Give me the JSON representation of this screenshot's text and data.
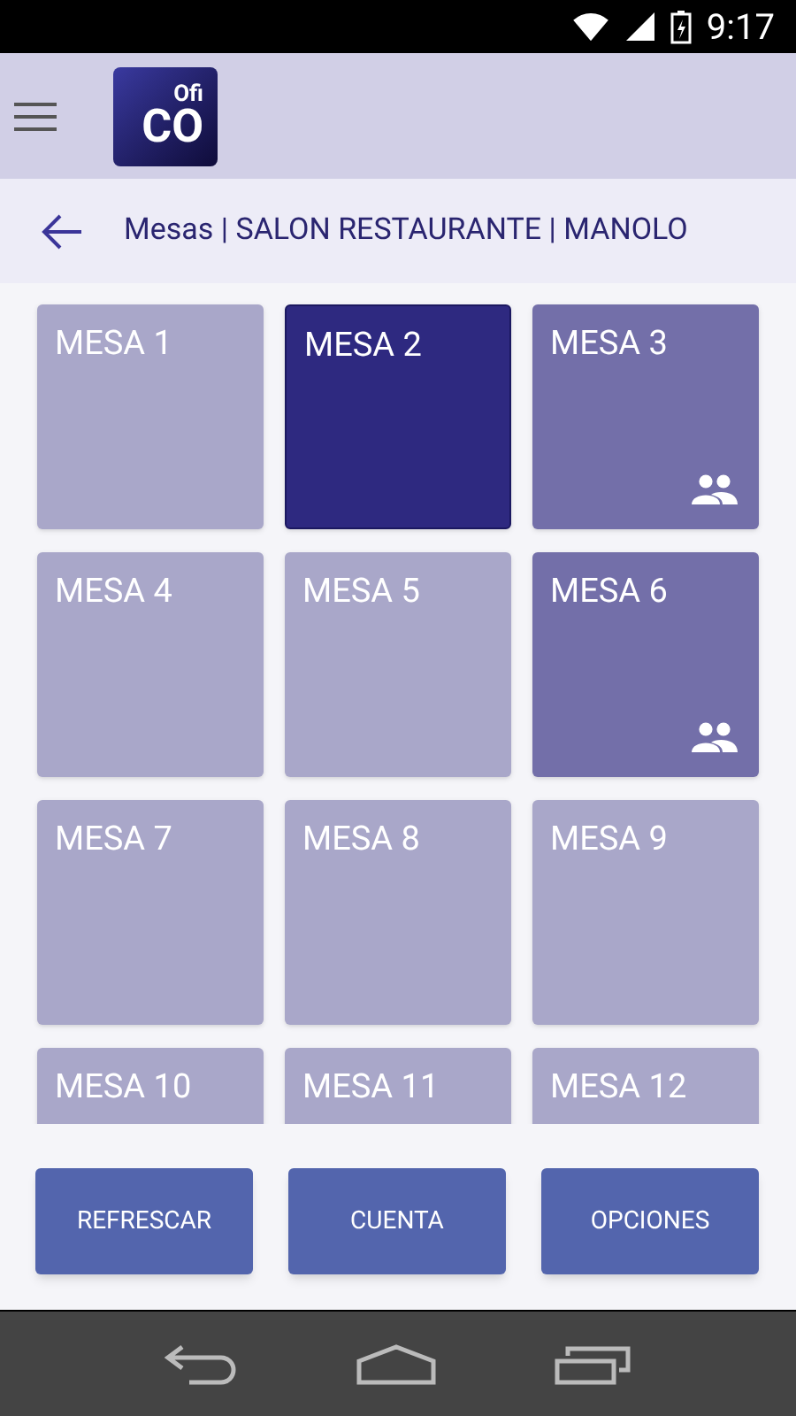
{
  "status_bar": {
    "time": "9:17"
  },
  "toolbar": {
    "logo": {
      "small": "Ofi",
      "large": "CO"
    }
  },
  "header": {
    "title": "Mesas | SALON RESTAURANTE | MANOLO"
  },
  "tables": [
    {
      "label": "MESA 1",
      "selected": false,
      "occupied": false
    },
    {
      "label": "MESA 2",
      "selected": true,
      "occupied": false
    },
    {
      "label": "MESA 3",
      "selected": false,
      "occupied": true
    },
    {
      "label": "MESA 4",
      "selected": false,
      "occupied": false
    },
    {
      "label": "MESA 5",
      "selected": false,
      "occupied": false
    },
    {
      "label": "MESA 6",
      "selected": false,
      "occupied": true
    },
    {
      "label": "MESA 7",
      "selected": false,
      "occupied": false
    },
    {
      "label": "MESA 8",
      "selected": false,
      "occupied": false
    },
    {
      "label": "MESA 9",
      "selected": false,
      "occupied": false
    },
    {
      "label": "MESA 10",
      "selected": false,
      "occupied": false
    },
    {
      "label": "MESA 11",
      "selected": false,
      "occupied": false
    },
    {
      "label": "MESA 12",
      "selected": false,
      "occupied": false
    }
  ],
  "buttons": [
    "REFRESCAR",
    "CUENTA",
    "OPCIONES"
  ]
}
